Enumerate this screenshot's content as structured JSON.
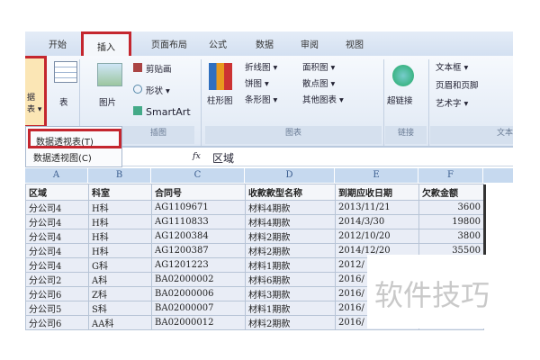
{
  "tabs": [
    "开始",
    "插入",
    "页面布局",
    "公式",
    "数据",
    "审阅",
    "视图"
  ],
  "ribbon": {
    "pivot_label": "据\n表 ▾",
    "table": "表",
    "picture": "图片",
    "clipart": "剪贴画",
    "shapes": "形状 ▾",
    "smartart": "SmartArt",
    "column_chart": "柱形图",
    "line": "折线图 ▾",
    "pie": "饼图 ▾",
    "bar": "条形图 ▾",
    "area": "面积图 ▾",
    "scatter": "散点图 ▾",
    "other": "其他图表 ▾",
    "hyperlink": "超链接",
    "textbox": "文本框 ▾",
    "header_footer": "页眉和页脚",
    "wordart": "艺术字 ▾",
    "groups": {
      "illustrations": "插图",
      "charts": "图表",
      "links": "链接",
      "text": "文本"
    }
  },
  "menu": {
    "items": [
      "数据透视表(T)",
      "数据透视图(C)"
    ]
  },
  "formula_bar": {
    "fx": "fx",
    "value": "区域"
  },
  "columns": [
    "A",
    "B",
    "C",
    "D",
    "E",
    "F"
  ],
  "headers": [
    "区域",
    "科室",
    "合同号",
    "收款款型名称",
    "到期应收日期",
    "欠款金额"
  ],
  "rows": [
    [
      "分公司4",
      "H科",
      "AG1109671",
      "材料4期款",
      "2013/11/21",
      "3600"
    ],
    [
      "分公司4",
      "H科",
      "AG1110833",
      "材料4期款",
      "2014/3/30",
      "19800"
    ],
    [
      "分公司4",
      "H科",
      "AG1200384",
      "材料2期款",
      "2012/10/20",
      "3800"
    ],
    [
      "分公司4",
      "H科",
      "AG1200387",
      "材料2期款",
      "2014/12/20",
      "35500"
    ],
    [
      "分公司4",
      "G科",
      "AG1201223",
      "材料1期款",
      "2012/",
      ""
    ],
    [
      "分公司2",
      "A科",
      "BA02000002",
      "材料6期款",
      "2016/",
      ""
    ],
    [
      "分公司6",
      "Z科",
      "BA02000006",
      "材料3期款",
      "2016/",
      ""
    ],
    [
      "分公司5",
      "S科",
      "BA02000007",
      "材料1期款",
      "2016/",
      ""
    ],
    [
      "分公司6",
      "AA科",
      "BA02000012",
      "材料2期款",
      "2016/",
      ""
    ]
  ],
  "watermark": "软件技巧"
}
